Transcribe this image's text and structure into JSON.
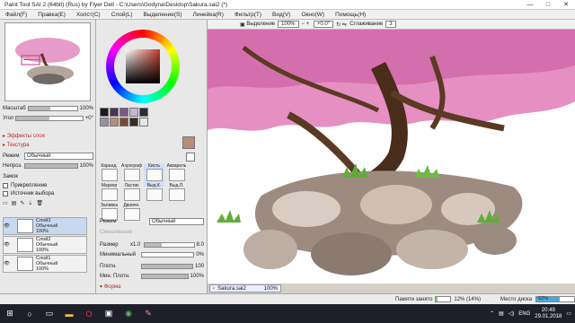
{
  "window": {
    "title": "Paint Tool SAI 2 (64bit) (Rus) by Flyer Dell - C:\\Users\\Godyna\\Desktop\\Sakura.sai2 (*)",
    "minimize": "—",
    "maximize": "□",
    "close": "✕"
  },
  "menu": [
    "Файл(F)",
    "Правка(E)",
    "Холст(C)",
    "Слой(L)",
    "Выделение(S)",
    "Линейка(R)",
    "Фильтр(T)",
    "Вид(V)",
    "Окно(W)",
    "Помощь(H)"
  ],
  "navigator": {
    "zoom_label": "Масштаб",
    "zoom_value": "100%",
    "angle_label": "Угол",
    "angle_value": "+0°",
    "zoom_fraction": 0.45,
    "angle_fraction": 0.5
  },
  "layer_props": {
    "effects_label": "Эффекты слоя",
    "texture_label": "Текстура",
    "mode_label": "Режим",
    "mode_value": "Обычный",
    "opacity_label": "Непроз.",
    "opacity_value": "100%",
    "opacity_fraction": 1.0,
    "lock_label": "Замок",
    "clip_label": "Прикрепление",
    "source_label": "Источник выбора"
  },
  "layers": [
    {
      "name": "Слой3",
      "mode": "Обычный",
      "opacity": "100%",
      "selected": true
    },
    {
      "name": "Слой2",
      "mode": "Обычный",
      "opacity": "100%",
      "selected": false
    },
    {
      "name": "Слой1",
      "mode": "Обычный",
      "opacity": "100%",
      "selected": false
    }
  ],
  "colors": {
    "current": "#b78e7c",
    "secondary": "#ffffff",
    "swatches": [
      "#1a1a22",
      "#4a3350",
      "#7a5a8a",
      "#c7b6d6",
      "#2b2b33",
      "#9a8fa3",
      "#b78e7c",
      "#7b4a3a",
      "#3a2a24",
      "#e6e6e6"
    ]
  },
  "tools": [
    {
      "label": "Каранд.",
      "selected": false
    },
    {
      "label": "Аэрограф",
      "selected": false
    },
    {
      "label": "Кисть",
      "selected": true
    },
    {
      "label": "Акварель",
      "selected": false
    },
    {
      "label": "Маркер",
      "selected": false
    },
    {
      "label": "Ластик",
      "selected": false
    },
    {
      "label": "Выд.К.",
      "selected": false
    },
    {
      "label": "Выд.Л.",
      "selected": false
    },
    {
      "label": "Заливка",
      "selected": false
    },
    {
      "label": "Двоичн.",
      "selected": false
    }
  ],
  "brush": {
    "mode_label": "Режим",
    "mode_value": "Обычный",
    "blend_label": "Смешивание",
    "size_label": "Размер",
    "size_mult": "x1.0",
    "size_value": "8.0",
    "min_label": "Минимальный",
    "min_value": "0%",
    "density_label": "Плотн.",
    "density_value": "100",
    "min_density_label": "Мин. Плотн.",
    "min_density_value": "100%",
    "shape_label": "Форма",
    "size_fraction": 0.35,
    "min_fraction": 0.0,
    "density_fraction": 1.0,
    "min_density_fraction": 1.0
  },
  "canvas_toolbar": {
    "selection_label": "Выделение",
    "zoom": "100%",
    "angle": "+0.0°",
    "smoothing_label": "Сглаживание",
    "smoothing_value": "3"
  },
  "document": {
    "tab_name": "Sakura.sai2",
    "tab_zoom": "100%"
  },
  "status": {
    "memory_label": "Памяти занято",
    "memory_value": "12% (14%)",
    "memory_fraction": 0.12,
    "disk_label": "Место диска",
    "disk_value": "62%",
    "disk_fraction": 0.62
  },
  "taskbar": {
    "lang": "ENG",
    "time": "20:49",
    "date": "29.01.2018"
  }
}
